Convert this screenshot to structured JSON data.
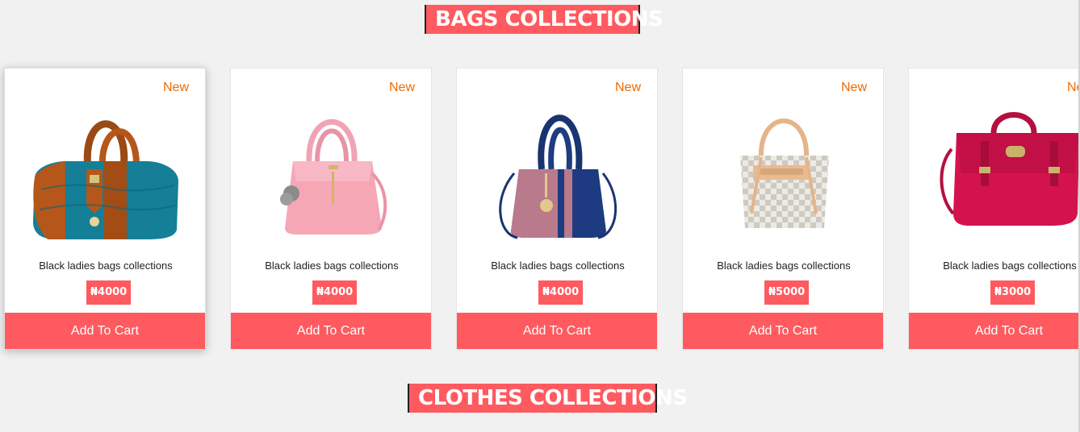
{
  "sections": {
    "bags_title": "BAGS COLLECTIONS",
    "clothes_title": "CLOTHES COLLECTIONS"
  },
  "products": [
    {
      "badge": "New",
      "name": "Black ladies bags collections",
      "price": "₦4000",
      "button": "Add To Cart",
      "image": "teal-brown-handbag"
    },
    {
      "badge": "New",
      "name": "Black ladies bags collections",
      "price": "₦4000",
      "button": "Add To Cart",
      "image": "pink-handbag"
    },
    {
      "badge": "New",
      "name": "Black ladies bags collections",
      "price": "₦4000",
      "button": "Add To Cart",
      "image": "navy-pink-handbag"
    },
    {
      "badge": "New",
      "name": "Black ladies bags collections",
      "price": "₦5000",
      "button": "Add To Cart",
      "image": "checkered-beige-handbag"
    },
    {
      "badge": "New",
      "name": "Black ladies bags collections",
      "price": "₦3000",
      "button": "Add To Cart",
      "image": "crimson-satchel"
    }
  ],
  "colors": {
    "accent": "#ff5a5f",
    "badge": "#ef6a00",
    "background": "#f1f1f1"
  }
}
